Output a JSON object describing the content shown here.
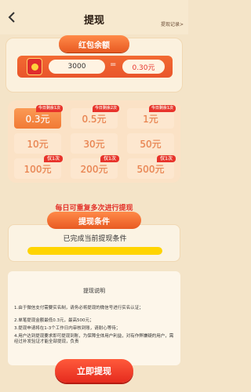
{
  "header": {
    "title": "提现",
    "records_link": "提现记录>",
    "back_icon": "chevron-left-icon"
  },
  "balance": {
    "ribbon": "红包余额",
    "coins": "3000",
    "equals": "=",
    "yuan": "0.30元",
    "icon": "red-envelope-icon"
  },
  "options": [
    {
      "value": "0.3元",
      "badge": "今日剩余1次",
      "selected": true
    },
    {
      "value": "0.5元",
      "badge": "今日剩余2次",
      "selected": false
    },
    {
      "value": "1元",
      "badge": "今日剩余1次",
      "selected": false
    },
    {
      "value": "10元",
      "badge": "",
      "selected": false
    },
    {
      "value": "30元",
      "badge": "",
      "selected": false
    },
    {
      "value": "50元",
      "badge": "",
      "selected": false
    },
    {
      "value": "100元",
      "badge": "仅1次",
      "selected": false
    },
    {
      "value": "200元",
      "badge": "仅1次",
      "selected": false
    },
    {
      "value": "500元",
      "badge": "仅1次",
      "selected": false
    }
  ],
  "repeat_text": "每日可重复多次进行提现",
  "conditions": {
    "title": "提现条件",
    "status": "已完成当前提现条件",
    "progress": 1.0
  },
  "explanation": {
    "title": "提现说明",
    "lines": [
      "1.由于微信支付需要实名制，请务必将提现的微信号进行实名认证；",
      "2.单笔提现金额最低0.3元，最高500元；",
      "3.提现申请将在1-3个工作日内审核到账，请耐心等待；",
      "4.用户达到提现要求即可提现到账，为保障全体用户利益，对有作弊嫌疑的用户，需经过补发验证才能全部提现，负责"
    ]
  },
  "submit_label": "立即提现",
  "colors": {
    "accent": "#e85a22",
    "red": "#e3322a",
    "background": "#f4e4c8"
  }
}
